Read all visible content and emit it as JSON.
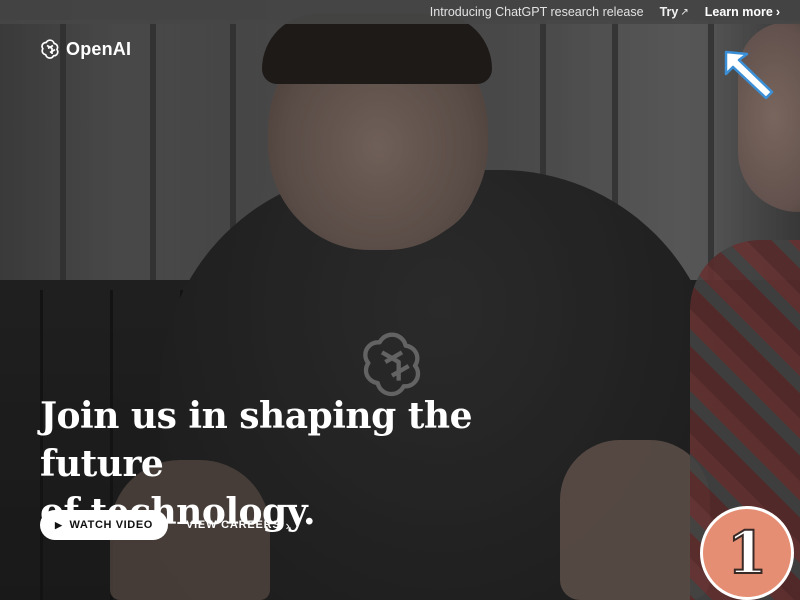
{
  "announcement": {
    "message": "Introducing ChatGPT research release",
    "try_label": "Try",
    "try_arrow": "↗",
    "learn_more_label": "Learn more",
    "learn_more_arrow": "›"
  },
  "brand": {
    "name": "OpenAI",
    "icon": "openai-logo-icon"
  },
  "hero": {
    "headline_line1": "Join us in shaping the future",
    "headline_line2": "of technology.",
    "watch_video_label": "WATCH VIDEO",
    "view_careers_label": "VIEW CAREERS",
    "careers_chevron": "›"
  },
  "overlay": {
    "step_number": "1",
    "cursor_icon": "mouse-pointer-icon",
    "step_badge_color": "#e58e74"
  },
  "colors": {
    "announcement_bg": "#464646",
    "text_primary": "#ffffff",
    "button_bg": "#ffffff"
  }
}
